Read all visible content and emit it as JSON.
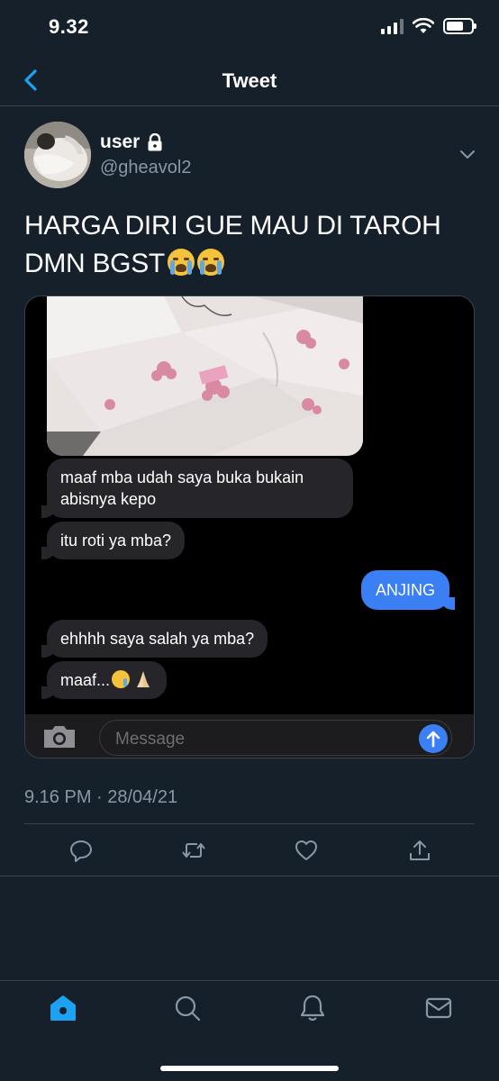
{
  "status_bar": {
    "time": "9.32"
  },
  "nav": {
    "title": "Tweet"
  },
  "tweet": {
    "display_name": "user",
    "handle": "@gheavol2",
    "text_line1": "HARGA DIRI GUE MAU DI TAROH",
    "text_line2": "DMN BGST",
    "timestamp": "9.16 PM · 28/04/21"
  },
  "media": {
    "messages": [
      {
        "side": "received",
        "text_line1": "maaf mba udah saya buka bukain",
        "text_line2": "abisnya kepo"
      },
      {
        "side": "received",
        "text": "itu roti ya mba?"
      },
      {
        "side": "sent",
        "text": "ANJING"
      },
      {
        "side": "received",
        "text": "ehhhh saya salah ya mba?"
      },
      {
        "side": "received",
        "text": "maaf..."
      }
    ],
    "compose_placeholder": "Message"
  },
  "icons": {
    "back": "back-icon",
    "lock": "lock-icon",
    "chevron": "chevron-down-icon",
    "reply": "reply-icon",
    "retweet": "retweet-icon",
    "like": "like-icon",
    "share": "share-icon",
    "home": "home-icon",
    "search": "search-icon",
    "notifications": "bell-icon",
    "messages": "mail-icon"
  },
  "colors": {
    "background": "#15202b",
    "accent": "#1da1f2",
    "secondary_text": "#8899a6",
    "sent_bubble": "#3b7ff5",
    "received_bubble": "#26252a"
  }
}
